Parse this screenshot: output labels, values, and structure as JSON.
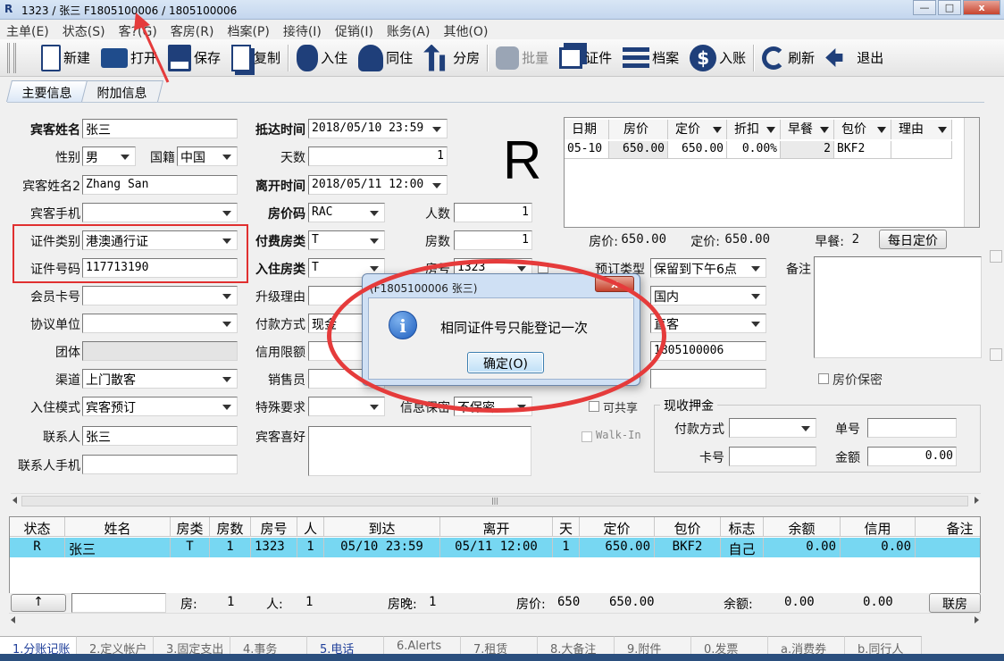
{
  "window": {
    "logo": "R",
    "title": "1323 / 张三 F1805100006 / 1805100006",
    "controls": [
      "—",
      "□",
      "x"
    ]
  },
  "menu": [
    "主单(E)",
    "状态(S)",
    "客?(G)",
    "客房(R)",
    "档案(P)",
    "接待(I)",
    "促销(I)",
    "账务(A)",
    "其他(O)"
  ],
  "toolbar": {
    "new": "新建",
    "open": "打开",
    "save": "保存",
    "copy": "复制",
    "checkin": "入住",
    "share": "同住",
    "split": "分房",
    "batch": "批量",
    "id": "证件",
    "profile": "档案",
    "post": "入账",
    "refresh": "刷新",
    "exit": "退出"
  },
  "tabs": {
    "main": "主要信息",
    "extra": "附加信息"
  },
  "guest": {
    "name_label": "宾客姓名",
    "name": "张三",
    "gender_label": "性别",
    "gender": "男",
    "nation_label": "国籍",
    "nation": "中国",
    "name2_label": "宾客姓名2",
    "name2": "Zhang San",
    "mobile_label": "宾客手机",
    "mobile": "",
    "idtype_label": "证件类别",
    "idtype": "港澳通行证",
    "idno_label": "证件号码",
    "idno": "117713190",
    "member_label": "会员卡号",
    "member": "",
    "agreement_label": "协议单位",
    "agreement": "",
    "group_label": "团体",
    "group": "",
    "channel_label": "渠道",
    "channel": "上门散客",
    "checkin_mode_label": "入住模式",
    "checkin_mode": "宾客预订",
    "contact_label": "联系人",
    "contact": "张三",
    "contact_mobile_label": "联系人手机",
    "contact_mobile": ""
  },
  "stay": {
    "arrive_label": "抵达时间",
    "arrive": "2018/05/10 23:59",
    "days_label": "天数",
    "days": "1",
    "depart_label": "离开时间",
    "depart": "2018/05/11 12:00",
    "ratecode_label": "房价码",
    "ratecode": "RAC",
    "persons_label": "人数",
    "persons": "1",
    "paytype_label": "付费房类",
    "paytype": "T",
    "rooms_label": "房数",
    "rooms": "1",
    "roomtype_label": "入住房类",
    "roomtype": "T",
    "roomno_label": "房号",
    "roomno": "1323",
    "upgrade_label": "升级理由",
    "upgrade": "",
    "payment_label": "付款方式",
    "payment": "现金",
    "credit_label": "信用限额",
    "credit": "",
    "sales_label": "销售员",
    "sales": "",
    "special_label": "特殊要求",
    "special": "",
    "info_secret_label": "信息保密",
    "info_secret": "不保密",
    "pref_label": "宾客喜好",
    "pref": ""
  },
  "reservation": {
    "type_label": "预订类型",
    "type": "保留到下午6点",
    "market": "国内",
    "source": "直客",
    "resno": "1805100006",
    "share_label": "可共享",
    "walkin_label": "Walk-In",
    "note_label": "备注",
    "secret_label": "房价保密"
  },
  "status_letter": "R",
  "rate_grid": {
    "headers": [
      "日期",
      "房价",
      "定价",
      "折扣",
      "早餐",
      "包价",
      "理由"
    ],
    "row": [
      "05-10",
      "650.00",
      "650.00",
      "0.00%",
      "2",
      "BKF2",
      ""
    ]
  },
  "rate_summary": {
    "price_label": "房价:",
    "price": "650.00",
    "fixed_label": "定价:",
    "fixed": "650.00",
    "breakfast_label": "早餐:",
    "breakfast": "2",
    "daily_button": "每日定价"
  },
  "deposit": {
    "title": "现收押金",
    "paytype_label": "付款方式",
    "paytype": "",
    "docno_label": "单号",
    "docno": "",
    "card_label": "卡号",
    "card": "",
    "amount_label": "金额",
    "amount": "0.00"
  },
  "list": {
    "headers": [
      "状态",
      "姓名",
      "房类",
      "房数",
      "房号",
      "人",
      "到达",
      "离开",
      "天",
      "定价",
      "包价",
      "标志",
      "余额",
      "信用",
      "备注"
    ],
    "row": [
      "R",
      "张三",
      "T",
      "1",
      "1323",
      "1",
      "05/10 23:59",
      "05/11 12:00",
      "1",
      "650.00",
      "BKF2",
      "自己",
      "0.00",
      "0.00",
      ""
    ]
  },
  "summary": {
    "up_button": "↑",
    "room_label": "房:",
    "room": "1",
    "person_label": "人:",
    "person": "1",
    "nights_label": "房晚:",
    "nights": "1",
    "price_label": "房价:",
    "price_a": "650",
    "price_b": "650.00",
    "balance_label": "余额:",
    "balance_a": "0.00",
    "balance_b": "0.00",
    "share_button": "联房"
  },
  "bottom_tabs": [
    "1.分账记账",
    "2.定义帐户",
    "3.固定支出",
    "4.事务",
    "5.电话",
    "6.Alerts",
    "7.租赁",
    "8.大备注",
    "9.附件",
    "0.发票",
    "a.消费券",
    "b.同行人"
  ],
  "dialog": {
    "title": "(F1805100006 张三)",
    "close": "x",
    "icon": "i",
    "message": "相同证件号只能登记一次",
    "ok": "确定(O)"
  },
  "colors": {
    "annotation": "#e53b3b",
    "selected_row": "#77d7f2",
    "icon": "#1f3f7a"
  }
}
